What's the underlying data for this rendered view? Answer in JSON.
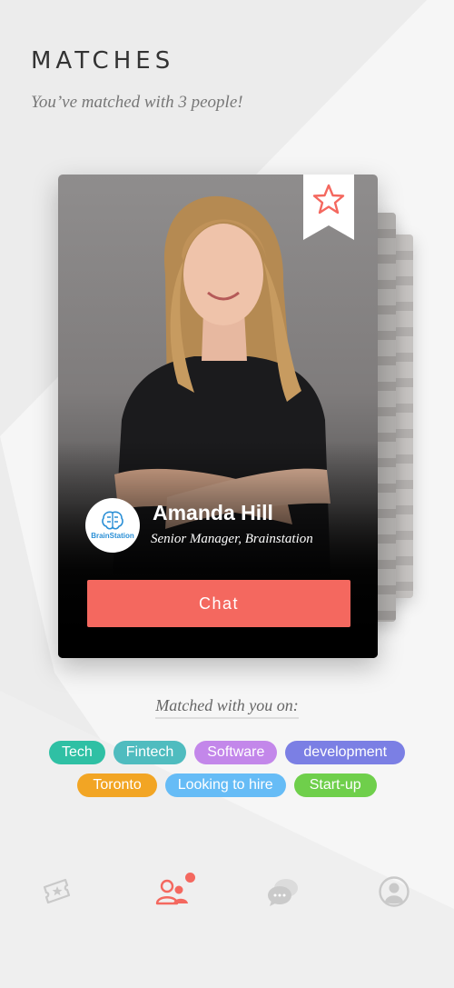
{
  "header": {
    "title": "MATCHES",
    "subtitle": "You’ve matched with 3 people!"
  },
  "card": {
    "name": "Amanda Hill",
    "role": "Senior Manager, Brainstation",
    "company_logo_text": "BrainStation",
    "chat_label": "Chat",
    "bookmark_icon": "star-icon"
  },
  "matched_on": {
    "label": "Matched with you on:",
    "tags": [
      {
        "label": "Tech",
        "color": "#2fc0a4"
      },
      {
        "label": "Fintech",
        "color": "#4fbcbf"
      },
      {
        "label": "Software",
        "color": "#c387ea"
      },
      {
        "label": "development",
        "color": "#7b7fe4"
      },
      {
        "label": "Toronto",
        "color": "#f2a524"
      },
      {
        "label": "Looking to hire",
        "color": "#66bcf6"
      },
      {
        "label": "Start-up",
        "color": "#6fcf4b"
      }
    ]
  },
  "tabbar": {
    "items": [
      {
        "icon": "ticket-star-icon",
        "active": false
      },
      {
        "icon": "people-icon",
        "active": true,
        "badge": true
      },
      {
        "icon": "chat-bubbles-icon",
        "active": false
      },
      {
        "icon": "profile-icon",
        "active": false
      }
    ]
  },
  "colors": {
    "accent": "#f4685f",
    "background": "#ececec"
  }
}
